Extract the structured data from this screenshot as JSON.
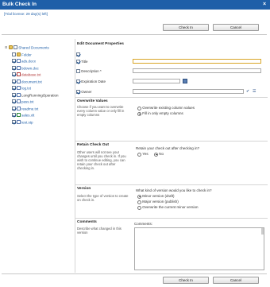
{
  "window": {
    "title": "Bulk Check In",
    "close_label": "×"
  },
  "license": "[Trial license: 29 day(s) left]",
  "buttons": {
    "checkin": "Check In",
    "cancel": "Cancel"
  },
  "tree": {
    "root": "Shared Documents",
    "items": [
      {
        "label": "Folder",
        "type": "folder",
        "checked": false,
        "color": "blue"
      },
      {
        "label": "ads.docx",
        "type": "doc",
        "checked": true,
        "color": "blue"
      },
      {
        "label": "bdown.doc",
        "type": "doc",
        "checked": true,
        "color": "blue"
      },
      {
        "label": "database.txt",
        "type": "doc",
        "checked": true,
        "color": "red"
      },
      {
        "label": "document.txt",
        "type": "doc",
        "checked": true,
        "color": "blue"
      },
      {
        "label": "log.txt",
        "type": "doc",
        "checked": true,
        "color": "blue"
      },
      {
        "label": "LongRunningOperation",
        "type": "doc",
        "checked": true,
        "color": "dark"
      },
      {
        "label": "pass.txt",
        "type": "doc",
        "checked": true,
        "color": "blue"
      },
      {
        "label": "readme.txt",
        "type": "doc",
        "checked": true,
        "color": "blue"
      },
      {
        "label": "sales.xlt",
        "type": "doc",
        "checked": true,
        "color": "green"
      },
      {
        "label": "test.stp",
        "type": "doc",
        "checked": true,
        "color": "blue"
      }
    ]
  },
  "props": {
    "heading": "Edit Document Properties",
    "fields": {
      "title": "Title",
      "description": "Description *",
      "expiration": "Expiration Date",
      "owner": "Owner"
    }
  },
  "overwrite": {
    "title": "Overwrite Values",
    "desc": "Choose if you want to overwrite every column value or only fill in empty columns",
    "options": [
      "Overwrite existing column values",
      "Fill in only empty columns"
    ],
    "selected": 1
  },
  "retain": {
    "title": "Retain Check Out",
    "desc": "Other users will not see your changes until you check in. If you wish to continue editing, you can retain your check out after checking in.",
    "question": "Retain your check out after checking in?",
    "options": [
      "Yes",
      "No"
    ],
    "selected": 1
  },
  "version": {
    "title": "Version",
    "desc": "Select the type of version to create on check in.",
    "question": "What kind of version would you like to check in?",
    "options": [
      "Minor version (draft)",
      "Major version (publish)",
      "Overwrite the current minor version"
    ],
    "selected": 0
  },
  "comments": {
    "title": "Comments",
    "desc": "Describe what changed in this version",
    "label": "Comments:"
  },
  "colors": {
    "titlebar": "#1f5fa8",
    "link": "#1f5fa8"
  }
}
